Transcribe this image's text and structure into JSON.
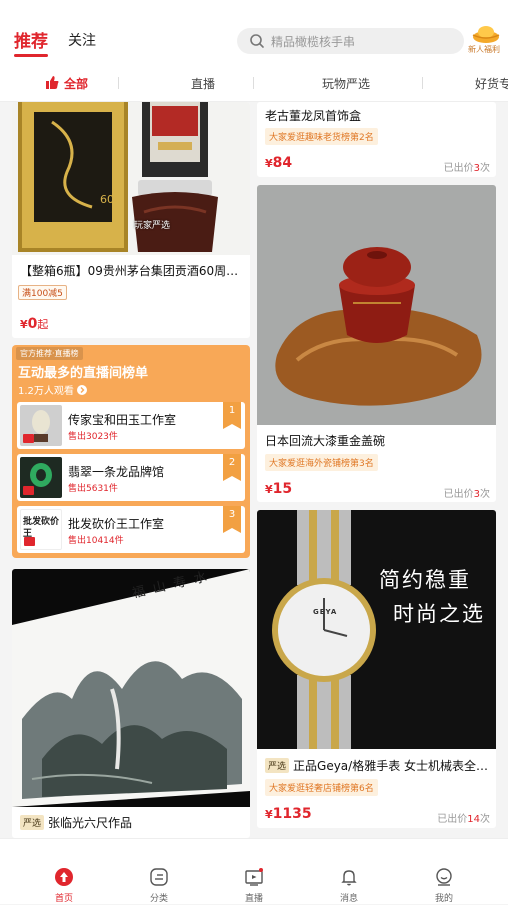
{
  "header": {
    "tabs": [
      {
        "label": "推荐",
        "active": true
      },
      {
        "label": "关注",
        "active": false
      }
    ],
    "search_placeholder": "精品橄榄核手串",
    "newcomer_label": "新人福利"
  },
  "categories": [
    {
      "label": "全部",
      "active": true
    },
    {
      "label": "直播",
      "active": false
    },
    {
      "label": "玩物严选",
      "active": false
    },
    {
      "label": "好货专",
      "active": false
    }
  ],
  "left_column": {
    "card1": {
      "title": "【整箱6瓶】09贵州茅台集团贡酒60周…",
      "coupon": "满100减5",
      "price_symbol": "¥",
      "price": "0",
      "price_suffix": "起",
      "image_badge": "玩家严选",
      "box_number": "60"
    },
    "live_panel": {
      "badge": "官方推荐·直播榜",
      "title": "互动最多的直播间榜单",
      "viewers": "1.2万人观看",
      "rows": [
        {
          "rank": "1",
          "name": "传家宝和田玉工作室",
          "sold": "售出3023件"
        },
        {
          "rank": "2",
          "name": "翡翠一条龙品牌馆",
          "sold": "售出5631件"
        },
        {
          "rank": "3",
          "name": "批发砍价王工作室",
          "sold": "售出10414件",
          "thumb_text": "批发砍价王"
        }
      ]
    },
    "card2": {
      "tag": "严选",
      "title": "张临光六尺作品",
      "painting_text": "福山寿水"
    }
  },
  "right_column": {
    "card1": {
      "title": "老古董龙凤首饰盒",
      "rank": "大家爱逛趣味老货榜第2名",
      "price_symbol": "¥",
      "price": "84",
      "sold_prefix": "已出价",
      "sold_count": "3",
      "sold_suffix": "次"
    },
    "card2": {
      "title": "日本回流大漆重金盖碗",
      "rank": "大家爱逛海外瓷铺榜第3名",
      "price_symbol": "¥",
      "price": "15",
      "sold_prefix": "已出价",
      "sold_count": "3",
      "sold_suffix": "次"
    },
    "card3": {
      "tag": "严选",
      "title": "正品Geya/格雅手表 女士机械表全…",
      "rank": "大家爱逛轻奢店铺榜第6名",
      "price_symbol": "¥",
      "price": "1135",
      "sold_prefix": "已出价",
      "sold_count": "14",
      "sold_suffix": "次",
      "ad_line1": "简约稳重",
      "ad_line2": "时尚之选",
      "watch_brand": "GEYA"
    }
  },
  "bottom_nav": [
    {
      "label": "首页",
      "active": true
    },
    {
      "label": "分类",
      "active": false
    },
    {
      "label": "直播",
      "active": false
    },
    {
      "label": "消息",
      "active": false
    },
    {
      "label": "我的",
      "active": false
    }
  ],
  "colors": {
    "accent": "#e0262d",
    "live_panel": "#f8a857"
  }
}
